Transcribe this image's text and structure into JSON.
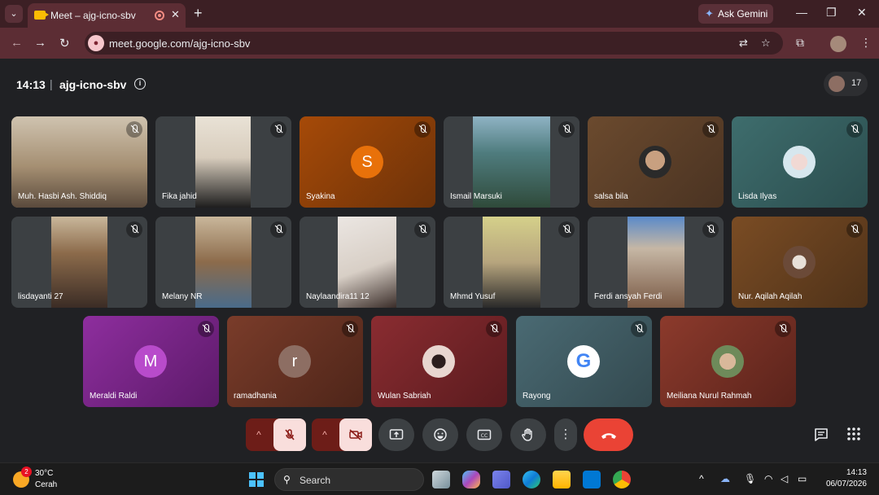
{
  "browser": {
    "tab_title": "Meet – ajg-icno-sbv",
    "tab_close": "✕",
    "new_tab": "+",
    "gemini_label": "Ask Gemini",
    "url": "meet.google.com/ajg-icno-sbv",
    "window_minimize": "—",
    "window_restore": "❐",
    "window_close": "✕"
  },
  "meeting": {
    "time": "14:13",
    "separator": "|",
    "code": "ajg-icno-sbv",
    "info": "i",
    "participant_count": "17"
  },
  "participants": [
    {
      "name": "Muh. Hasbi Ash. Shiddiq",
      "type": "video"
    },
    {
      "name": "Fika jahid",
      "type": "video"
    },
    {
      "name": "Syakina",
      "type": "initial",
      "initial": "S",
      "avatar_color": "#e8710a"
    },
    {
      "name": "Ismail Marsuki",
      "type": "video"
    },
    {
      "name": "salsa bila",
      "type": "photo"
    },
    {
      "name": "Lisda Ilyas",
      "type": "photo"
    },
    {
      "name": "lisdayanti 27",
      "type": "video"
    },
    {
      "name": "Melany NR",
      "type": "video"
    },
    {
      "name": "Naylaandira11 12",
      "type": "video"
    },
    {
      "name": "Mhmd Yusuf",
      "type": "video"
    },
    {
      "name": "Ferdi ansyah Ferdi",
      "type": "video"
    },
    {
      "name": "Nur. Aqilah Aqilah",
      "type": "photo"
    },
    {
      "name": "Meraldi Raldi",
      "type": "initial",
      "initial": "M",
      "avatar_color": "#a142b5"
    },
    {
      "name": "ramadhania",
      "type": "initial",
      "initial": "r",
      "avatar_color": "#8d6e63"
    },
    {
      "name": "Wulan Sabriah",
      "type": "photo"
    },
    {
      "name": "Rayong",
      "type": "photo"
    },
    {
      "name": "Meiliana Nurul Rahmah",
      "type": "photo"
    }
  ],
  "controls": {
    "chevron": "^",
    "more": "⋮"
  },
  "taskbar": {
    "notification_count": "2",
    "temperature": "30°C",
    "weather": "Cerah",
    "search_placeholder": "Search",
    "time": "14:13",
    "date": "06/07/2026"
  },
  "colors": {
    "leave": "#ea4335",
    "muted_fill": "#f9dedc",
    "muted_group": "#6d1d18",
    "tab_bar": "#3c1f24"
  }
}
